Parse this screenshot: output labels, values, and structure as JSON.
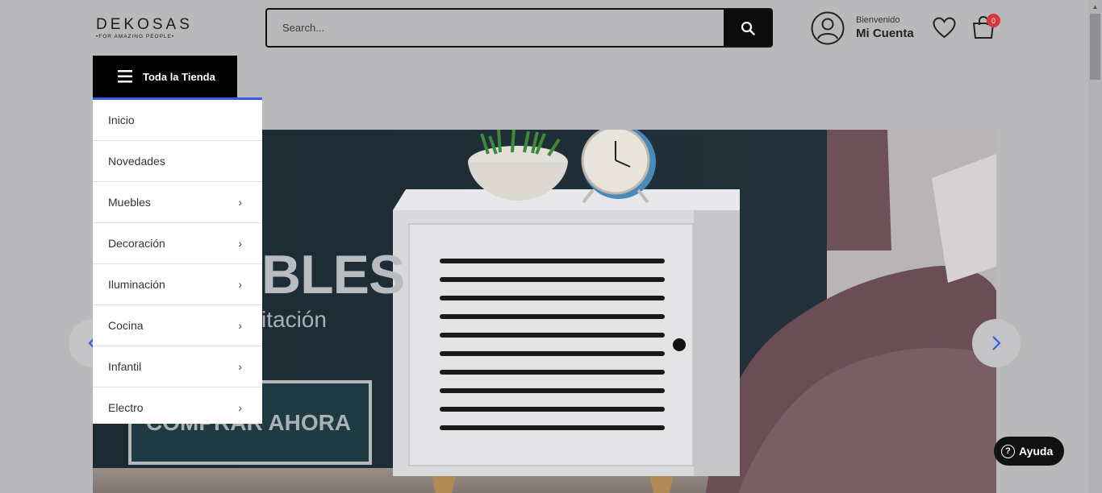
{
  "brand": {
    "name": "DEKOSAS",
    "tagline": "•FOR AMAZING PEOPLE•"
  },
  "search": {
    "placeholder": "Search...",
    "button_icon": "search-icon"
  },
  "account": {
    "welcome": "Bienvenido",
    "label": "Mi Cuenta",
    "icon": "user-icon"
  },
  "wishlist": {
    "icon": "heart-icon"
  },
  "cart": {
    "icon": "bag-icon",
    "count": "0"
  },
  "categories": {
    "toggle_label": "Toda la Tienda",
    "items": [
      {
        "label": "Inicio",
        "has_submenu": false
      },
      {
        "label": "Novedades",
        "has_submenu": false
      },
      {
        "label": "Muebles",
        "has_submenu": true
      },
      {
        "label": "Decoración",
        "has_submenu": true
      },
      {
        "label": "Iluminación",
        "has_submenu": true
      },
      {
        "label": "Cocina",
        "has_submenu": true
      },
      {
        "label": "Infantil",
        "has_submenu": true
      },
      {
        "label": "Electro",
        "has_submenu": true
      }
    ]
  },
  "hero": {
    "headline": "BLES",
    "subline": "itación",
    "cta": "COMPRAR AHORA"
  },
  "help": {
    "label": "Ayuda"
  },
  "colors": {
    "accent": "#2f5de3",
    "badge": "#d9363e",
    "dark": "#0c0c0c"
  }
}
